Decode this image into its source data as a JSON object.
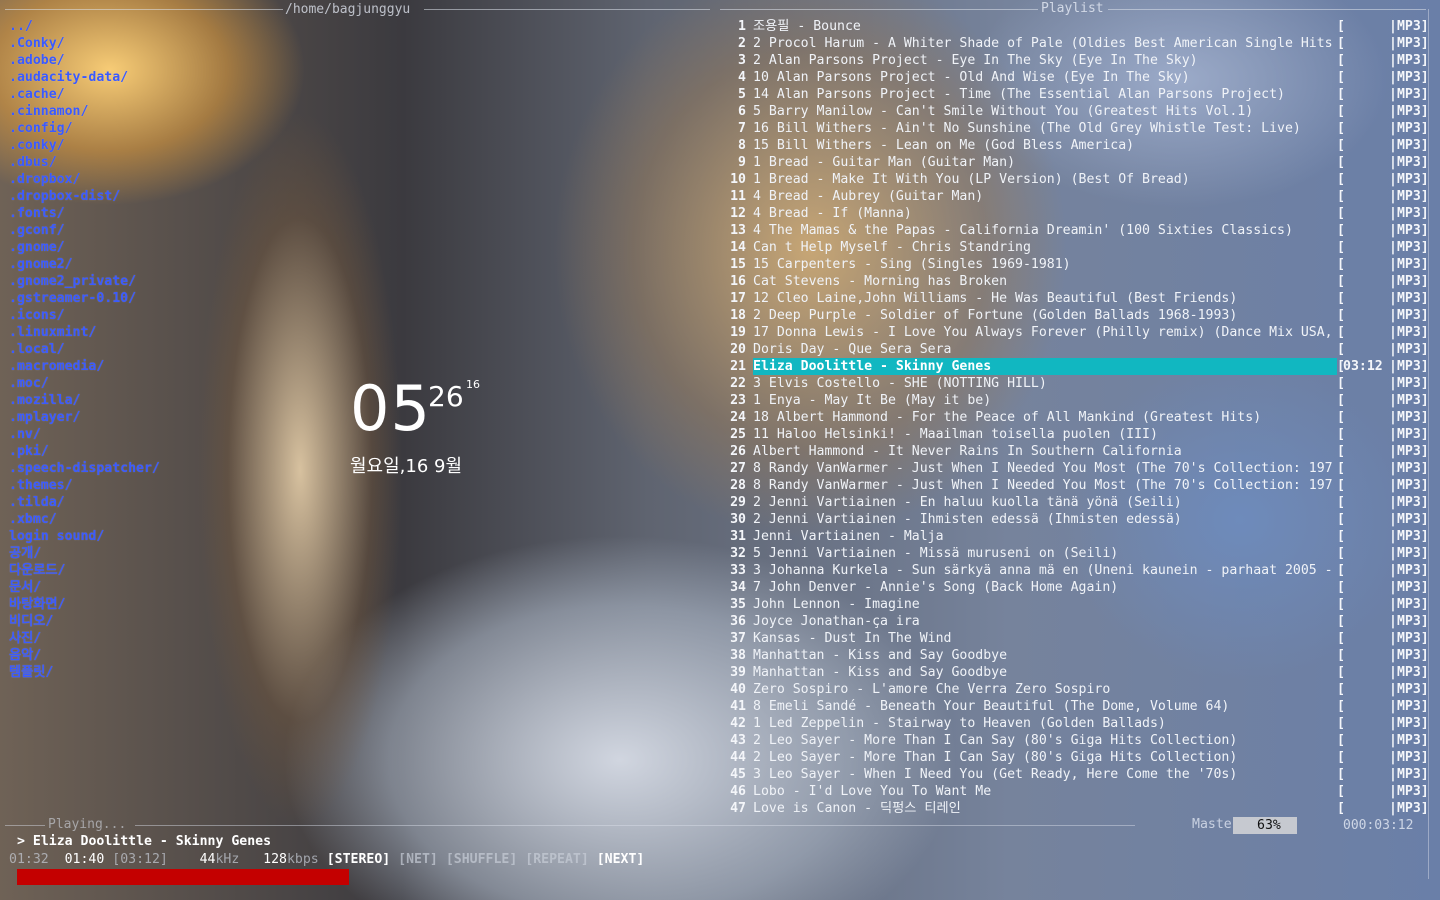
{
  "left_pane": {
    "path": "/home/bagjunggyu",
    "files": [
      "../",
      ".Conky/",
      ".adobe/",
      ".audacity-data/",
      ".cache/",
      ".cinnamon/",
      ".config/",
      ".conky/",
      ".dbus/",
      ".dropbox/",
      ".dropbox-dist/",
      ".fonts/",
      ".gconf/",
      ".gnome/",
      ".gnome2/",
      ".gnome2_private/",
      ".gstreamer-0.10/",
      ".icons/",
      ".linuxmint/",
      ".local/",
      ".macromedia/",
      ".moc/",
      ".mozilla/",
      ".mplayer/",
      ".nv/",
      ".pki/",
      ".speech-dispatcher/",
      ".themes/",
      ".tilda/",
      ".xbmc/",
      "login sound/",
      "공개/",
      "다운로드/",
      "문서/",
      "바탕화면/",
      "비디오/",
      "사진/",
      "음악/",
      "템플릿/"
    ]
  },
  "clock": {
    "hour": "05",
    "minute": "26",
    "second": "16",
    "date": "월요일,16 9월"
  },
  "playlist": {
    "title": "Playlist",
    "format_label": "|MP3]",
    "rows": [
      {
        "n": "1",
        "t": "조용필 - Bounce"
      },
      {
        "n": "2",
        "t": "2 Procol Harum - A Whiter Shade of Pale (Oldies Best American Single Hits"
      },
      {
        "n": "3",
        "t": "2 Alan Parsons Project - Eye In The Sky (Eye In The Sky)"
      },
      {
        "n": "4",
        "t": "10 Alan Parsons Project - Old And Wise (Eye In The Sky)"
      },
      {
        "n": "5",
        "t": "14 Alan Parsons Project - Time (The Essential Alan Parsons Project)"
      },
      {
        "n": "6",
        "t": "5 Barry Manilow - Can't Smile Without You (Greatest Hits Vol.1)"
      },
      {
        "n": "7",
        "t": "16 Bill Withers - Ain't No Sunshine (The Old Grey Whistle Test: Live)"
      },
      {
        "n": "8",
        "t": "15 Bill Withers - Lean on Me (God Bless America)"
      },
      {
        "n": "9",
        "t": "1 Bread - Guitar Man (Guitar Man)"
      },
      {
        "n": "10",
        "t": "1 Bread - Make It With You (LP Version) (Best Of Bread)"
      },
      {
        "n": "11",
        "t": "4 Bread - Aubrey (Guitar Man)"
      },
      {
        "n": "12",
        "t": "4 Bread - If (Manna)"
      },
      {
        "n": "13",
        "t": "4 The Mamas & the Papas - California Dreamin' (100 Sixties Classics)"
      },
      {
        "n": "14",
        "t": "Can t Help Myself - Chris Standring"
      },
      {
        "n": "15",
        "t": "15 Carpenters - Sing (Singles 1969-1981)"
      },
      {
        "n": "16",
        "t": "Cat Stevens - Morning has Broken"
      },
      {
        "n": "17",
        "t": "12 Cleo Laine,John Williams - He Was Beautiful (Best Friends)"
      },
      {
        "n": "18",
        "t": "2 Deep Purple - Soldier of Fortune (Golden Ballads 1968-1993)"
      },
      {
        "n": "19",
        "t": "17 Donna Lewis - I Love You Always Forever (Philly remix) (Dance Mix USA,"
      },
      {
        "n": "20",
        "t": "Doris Day - Que Sera Sera"
      },
      {
        "n": "21",
        "t": "Eliza Doolittle - Skinny Genes",
        "current": true,
        "time": "03:12"
      },
      {
        "n": "22",
        "t": "3 Elvis Costello - SHE (NOTTING HILL)"
      },
      {
        "n": "23",
        "t": "1 Enya - May It Be (May it be)"
      },
      {
        "n": "24",
        "t": "18 Albert Hammond - For the Peace of All Mankind (Greatest Hits)"
      },
      {
        "n": "25",
        "t": "11 Haloo Helsinki! - Maailman toisella puolen (III)"
      },
      {
        "n": "26",
        "t": "Albert Hammond - It Never Rains In Southern California"
      },
      {
        "n": "27",
        "t": "8 Randy VanWarmer - Just When I Needed You Most (The 70's Collection: 197"
      },
      {
        "n": "28",
        "t": "8 Randy VanWarmer - Just When I Needed You Most (The 70's Collection: 197"
      },
      {
        "n": "29",
        "t": "2 Jenni Vartiainen - En haluu kuolla tänä yönä (Seili)"
      },
      {
        "n": "30",
        "t": "2 Jenni Vartiainen - Ihmisten edessä (Ihmisten edessä)"
      },
      {
        "n": "31",
        "t": "Jenni Vartiainen - Malja"
      },
      {
        "n": "32",
        "t": "5 Jenni Vartiainen - Missä muruseni on (Seili)"
      },
      {
        "n": "33",
        "t": "3 Johanna Kurkela - Sun särkyä anna mä en (Uneni kaunein - parhaat 2005 -"
      },
      {
        "n": "34",
        "t": "7 John Denver - Annie's Song (Back Home Again)"
      },
      {
        "n": "35",
        "t": "John Lennon - Imagine"
      },
      {
        "n": "36",
        "t": "Joyce Jonathan-ça ira"
      },
      {
        "n": "37",
        "t": "Kansas - Dust In The Wind"
      },
      {
        "n": "38",
        "t": " Manhattan - Kiss and Say Goodbye"
      },
      {
        "n": "39",
        "t": " Manhattan - Kiss and Say Goodbye"
      },
      {
        "n": "40",
        "t": " Zero Sospiro - L'amore Che Verra   Zero Sospiro"
      },
      {
        "n": "41",
        "t": "8 Emeli Sandé - Beneath Your Beautiful (The Dome, Volume 64)"
      },
      {
        "n": "42",
        "t": "1 Led Zeppelin - Stairway to Heaven (Golden Ballads)"
      },
      {
        "n": "43",
        "t": "2 Leo Sayer - More Than I Can Say (80's Giga Hits Collection)"
      },
      {
        "n": "44",
        "t": "2 Leo Sayer - More Than I Can Say (80's Giga Hits Collection)"
      },
      {
        "n": "45",
        "t": "3 Leo Sayer - When I Need You (Get Ready, Here Come the '70s)"
      },
      {
        "n": "46",
        "t": "Lobo - I'd Love You To Want Me"
      },
      {
        "n": "47",
        "t": "Love is Canon - 딕펑스 티레인"
      }
    ]
  },
  "status": {
    "playing_label": "Playing...",
    "now_playing": "> Eliza Doolittle - Skinny Genes",
    "elapsed_a": "01:32",
    "elapsed_b": "01:40",
    "total": "[03:12]",
    "khz_value": "44",
    "khz_label": "kHz",
    "kbps_value": "128",
    "kbps_label": "kbps",
    "stereo": "[STEREO]",
    "net": "[NET]",
    "shuffle": "[SHUFFLE]",
    "repeat": "[REPEAT]",
    "next": "[NEXT]",
    "progress_fraction": 0.5,
    "master_label": "Master",
    "volume": "63%",
    "playlist_total": "000:03:12",
    "progress_color": "#c40000",
    "highlight_color": "#11b7c1",
    "file_color": "#3a5aff"
  }
}
